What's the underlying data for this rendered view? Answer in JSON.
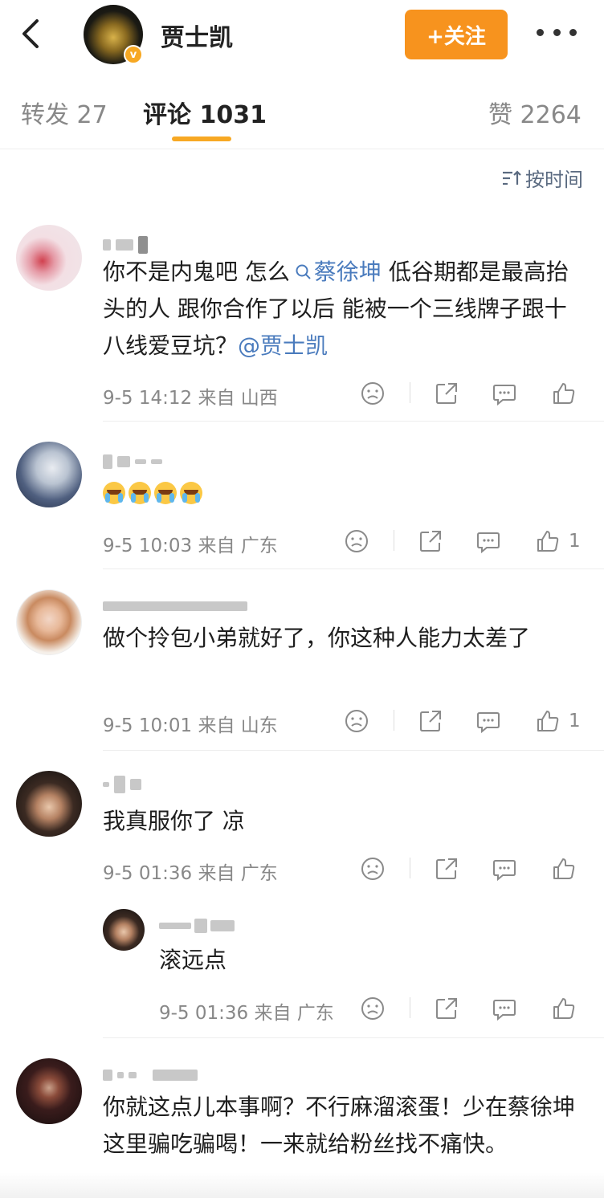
{
  "header": {
    "author_name": "贾士凯",
    "verified_badge": "v",
    "follow_label": "+关注",
    "back_icon": "chevron-left-icon",
    "more_icon": "more-horizontal-icon"
  },
  "tabs": [
    {
      "label": "转发 27"
    },
    {
      "label": "评论 1031"
    },
    {
      "label": "赞 2264"
    }
  ],
  "sort": {
    "label": "按时间",
    "icon": "sort-icon"
  },
  "comments": [
    {
      "text_before": "你不是内鬼吧 怎么",
      "topic": "蔡徐坤",
      "text_after": " 低谷期都是最高抬头的人 跟你合作了以后 能被一个三线牌子跟十八线爱豆坑？",
      "mention": "@贾士凯",
      "meta": "9-5 14:12 来自 山西",
      "likes": ""
    },
    {
      "text": "",
      "emoji_count": 4,
      "meta": "9-5 10:03 来自 广东",
      "likes": "1"
    },
    {
      "text": "做个拎包小弟就好了，你这种人能力太差了",
      "meta": "9-5 10:01 来自 山东",
      "likes": "1"
    },
    {
      "text": "我真服你了 凉",
      "meta": "9-5 01:36 来自 广东",
      "likes": "",
      "reply": {
        "text": "滚远点",
        "meta": "9-5 01:36 来自 广东"
      }
    },
    {
      "text": "你就这点儿本事啊？不行麻溜滚蛋！少在蔡徐坤这里骗吃骗喝！一来就给粉丝找不痛快。",
      "meta": "",
      "likes": ""
    }
  ],
  "colors": {
    "accent": "#f7931e",
    "tab_underline": "#f7a823",
    "link": "#4a7bbd"
  }
}
